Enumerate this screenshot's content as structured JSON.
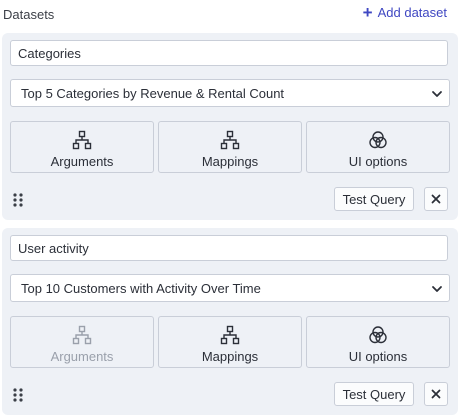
{
  "header": {
    "title": "Datasets",
    "add_label": "Add dataset",
    "accent_color": "#3f47c2"
  },
  "datasets": [
    {
      "name": "Categories",
      "query": "Top 5 Categories by Revenue & Rental Count",
      "tiles": [
        {
          "label": "Arguments",
          "icon": "hierarchy-icon",
          "enabled": true
        },
        {
          "label": "Mappings",
          "icon": "hierarchy-icon",
          "enabled": true
        },
        {
          "label": "UI options",
          "icon": "venn-icon",
          "enabled": true
        }
      ],
      "test_label": "Test Query"
    },
    {
      "name": "User activity",
      "query": "Top 10 Customers with Activity Over Time",
      "tiles": [
        {
          "label": "Arguments",
          "icon": "hierarchy-icon",
          "enabled": false
        },
        {
          "label": "Mappings",
          "icon": "hierarchy-icon",
          "enabled": true
        },
        {
          "label": "UI options",
          "icon": "venn-icon",
          "enabled": true
        }
      ],
      "test_label": "Test Query"
    }
  ]
}
